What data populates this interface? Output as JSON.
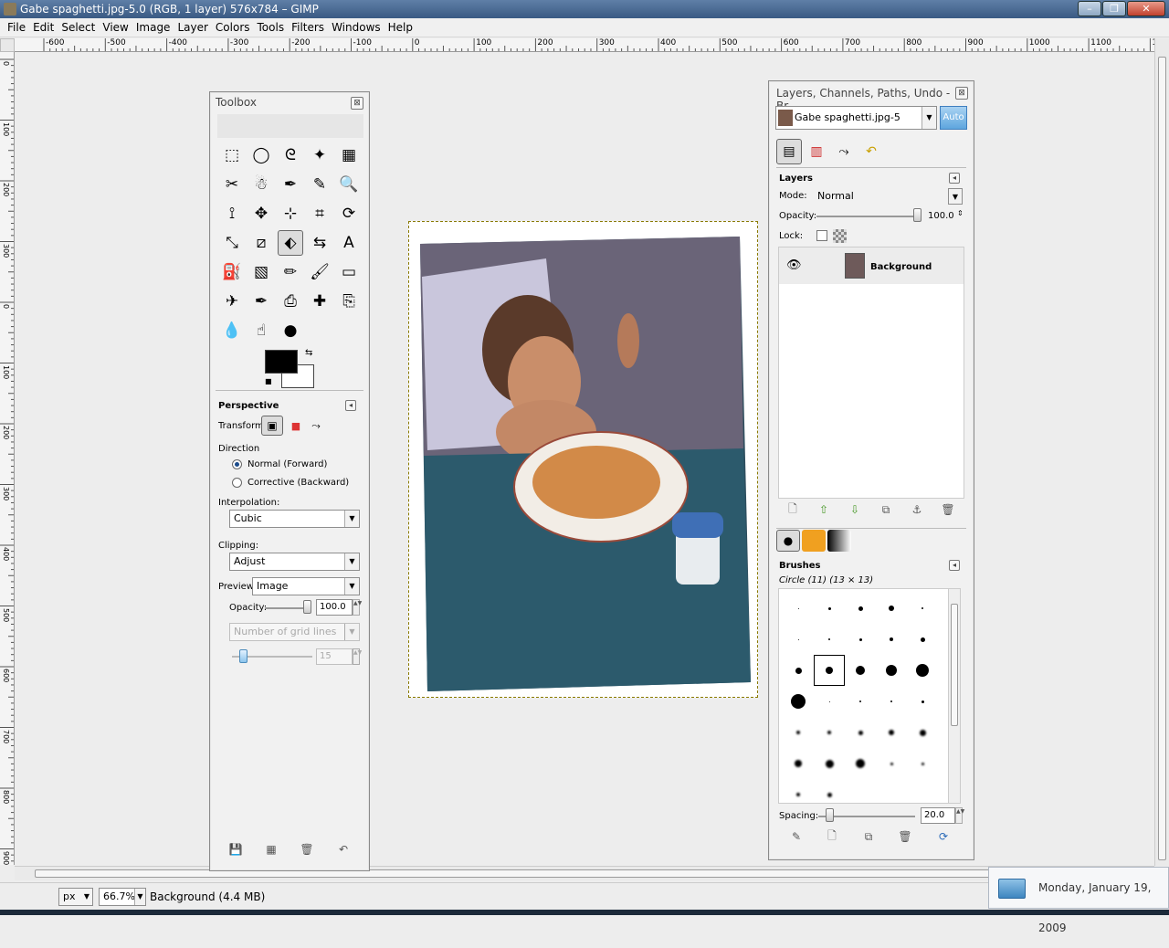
{
  "window": {
    "title": "Gabe spaghetti.jpg-5.0 (RGB, 1 layer) 576x784 – GIMP",
    "minimize": "–",
    "maximize": "❐",
    "close": "✕"
  },
  "menu": [
    "File",
    "Edit",
    "Select",
    "View",
    "Image",
    "Layer",
    "Colors",
    "Tools",
    "Filters",
    "Windows",
    "Help"
  ],
  "rulers": {
    "h_labels": [
      "-600",
      "-500",
      "-400",
      "-300",
      "-200",
      "-100",
      "0",
      "100",
      "200",
      "300",
      "400",
      "500",
      "600",
      "700",
      "800",
      "900",
      "1000",
      "1100",
      "12"
    ],
    "v_labels": [
      "0",
      "100",
      "200",
      "300",
      "0",
      "100",
      "200",
      "300",
      "400",
      "500",
      "600",
      "700",
      "800",
      "900"
    ]
  },
  "toolbox": {
    "title": "Toolbox",
    "tool_icons": [
      "rect-select-icon",
      "ellipse-select-icon",
      "lasso-icon",
      "fuzzy-select-icon",
      "color-select-icon",
      "scissors-icon",
      "foreground-select-icon",
      "paths-icon",
      "color-picker-icon",
      "zoom-icon",
      "measure-icon",
      "move-icon",
      "align-icon",
      "crop-icon",
      "rotate-icon",
      "scale-icon",
      "shear-icon",
      "perspective-icon",
      "flip-icon",
      "text-icon",
      "bucket-fill-icon",
      "blend-icon",
      "pencil-icon",
      "paintbrush-icon",
      "eraser-icon",
      "airbrush-icon",
      "ink-icon",
      "clone-icon",
      "heal-icon",
      "perspective-clone-icon",
      "blur-icon",
      "smudge-icon",
      "dodge-burn-icon"
    ],
    "fg_color": "#000000",
    "bg_color": "#ffffff",
    "options_title": "Perspective",
    "transform_label": "Transform:",
    "direction_label": "Direction",
    "direction_options": [
      "Normal (Forward)",
      "Corrective (Backward)"
    ],
    "interpolation_label": "Interpolation:",
    "interpolation_value": "Cubic",
    "clipping_label": "Clipping:",
    "clipping_value": "Adjust",
    "preview_label": "Preview:",
    "preview_value": "Image",
    "opacity_label": "Opacity:",
    "opacity_value": "100.0",
    "grid_select": "Number of grid lines",
    "grid_value": "15"
  },
  "layers_dock": {
    "title": "Layers, Channels, Paths, Undo - Br...",
    "image_select": "Gabe spaghetti.jpg-5",
    "auto_label": "Auto",
    "layers_title": "Layers",
    "mode_label": "Mode:",
    "mode_value": "Normal",
    "opacity_label": "Opacity:",
    "opacity_value": "100.0",
    "lock_label": "Lock:",
    "layer_name": "Background",
    "brushes_title": "Brushes",
    "brush_name": "Circle (11) (13 × 13)",
    "spacing_label": "Spacing:",
    "spacing_value": "20.0"
  },
  "status": {
    "unit": "px",
    "zoom": "66.7%",
    "info": "Background (4.4 MB)"
  },
  "clock": {
    "date": "Monday, January 19, 2009"
  }
}
